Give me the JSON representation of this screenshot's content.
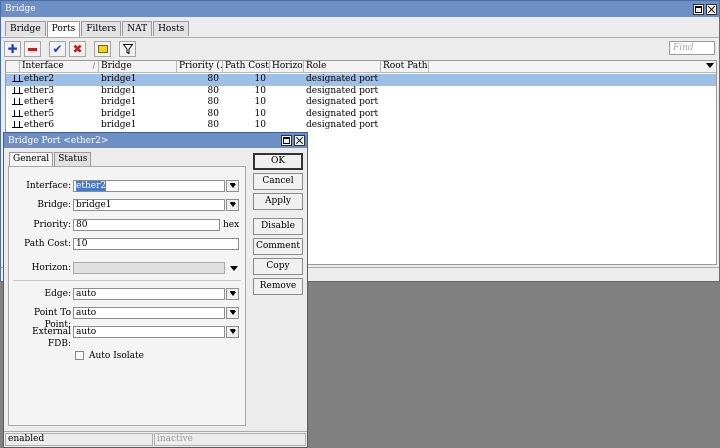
{
  "main_window": {
    "title": "Bridge",
    "tabs": [
      "Bridge",
      "Ports",
      "Filters",
      "NAT",
      "Hosts"
    ],
    "active_tab": 1,
    "toolbar": {
      "add_icon": "plus-icon",
      "remove_icon": "minus-icon",
      "enable_icon": "check-icon",
      "disable_icon": "x-icon",
      "comment_icon": "note-icon",
      "filter_icon": "funnel-icon"
    },
    "find_placeholder": "Find",
    "columns": [
      "Interface",
      "Bridge",
      "Priority (...",
      "Path Cost",
      "Horizon",
      "Role",
      "Root Path..."
    ],
    "rows": [
      {
        "interface": "ether2",
        "bridge": "bridge1",
        "priority": "80",
        "path_cost": "10",
        "horizon": "",
        "role": "designated port",
        "root_path": "",
        "selected": true
      },
      {
        "interface": "ether3",
        "bridge": "bridge1",
        "priority": "80",
        "path_cost": "10",
        "horizon": "",
        "role": "designated port",
        "root_path": "",
        "selected": false
      },
      {
        "interface": "ether4",
        "bridge": "bridge1",
        "priority": "80",
        "path_cost": "10",
        "horizon": "",
        "role": "designated port",
        "root_path": "",
        "selected": false
      },
      {
        "interface": "ether5",
        "bridge": "bridge1",
        "priority": "80",
        "path_cost": "10",
        "horizon": "",
        "role": "designated port",
        "root_path": "",
        "selected": false
      },
      {
        "interface": "ether6",
        "bridge": "bridge1",
        "priority": "80",
        "path_cost": "10",
        "horizon": "",
        "role": "designated port",
        "root_path": "",
        "selected": false
      }
    ]
  },
  "dialog": {
    "title": "Bridge Port <ether2>",
    "tabs": [
      "General",
      "Status"
    ],
    "active_tab": 0,
    "fields": {
      "interface": {
        "label": "Interface:",
        "value": "ether2"
      },
      "bridge": {
        "label": "Bridge:",
        "value": "bridge1"
      },
      "priority": {
        "label": "Priority:",
        "value": "80",
        "unit": "hex"
      },
      "path_cost": {
        "label": "Path Cost:",
        "value": "10"
      },
      "horizon": {
        "label": "Horizon:",
        "value": ""
      },
      "edge": {
        "label": "Edge:",
        "value": "auto"
      },
      "point_to_point": {
        "label": "Point To Point:",
        "value": "auto"
      },
      "external_fdb": {
        "label": "External FDB:",
        "value": "auto"
      },
      "auto_isolate": {
        "label": "Auto Isolate",
        "checked": false
      }
    },
    "buttons": [
      "OK",
      "Cancel",
      "Apply",
      "Disable",
      "Comment",
      "Copy",
      "Remove"
    ],
    "status": {
      "left": "enabled",
      "right": "inactive"
    }
  },
  "colors": {
    "titlebar": "#6d8fc4",
    "selection": "#9dbfe8",
    "add_blue": "#1f3fb8",
    "remove_red": "#c0201c",
    "check_blue": "#1f3fb8",
    "x_red": "#c0201c",
    "note_yellow": "#f2d21a"
  }
}
